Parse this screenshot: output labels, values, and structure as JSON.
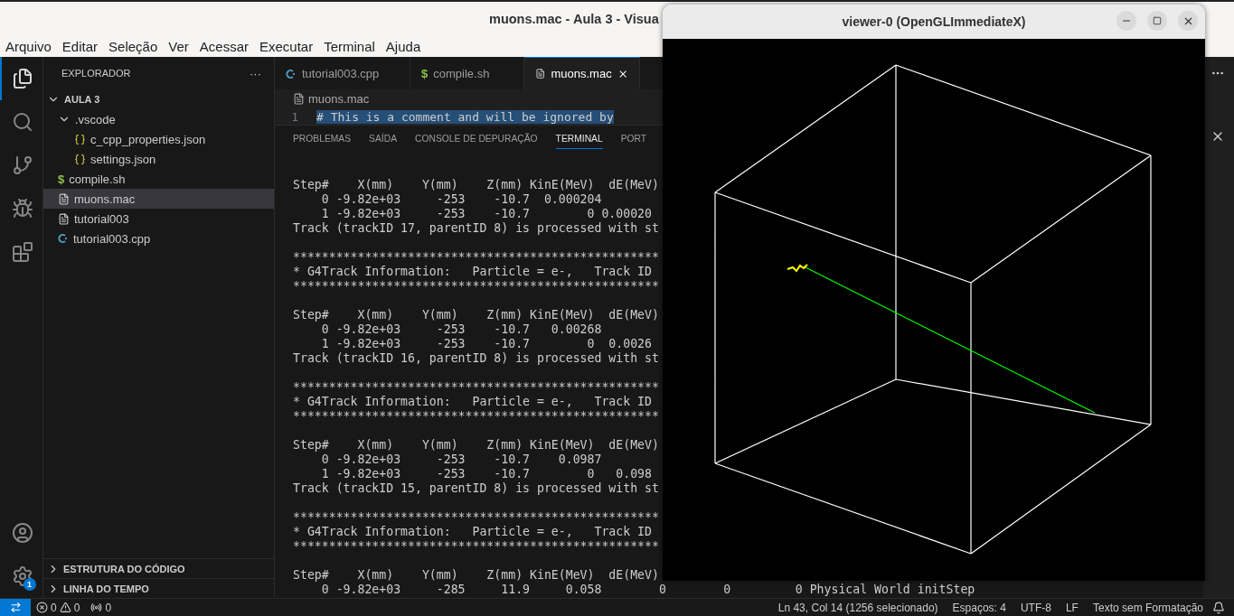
{
  "window": {
    "title": "muons.mac - Aula 3 - Visua"
  },
  "menu": [
    "Arquivo",
    "Editar",
    "Seleção",
    "Ver",
    "Acessar",
    "Executar",
    "Terminal",
    "Ajuda"
  ],
  "activity_bar": [
    {
      "kind": "files",
      "selected": true
    },
    {
      "kind": "search",
      "selected": false
    },
    {
      "kind": "source-control",
      "selected": false
    },
    {
      "kind": "run-debug",
      "selected": false
    },
    {
      "kind": "extensions",
      "selected": false
    }
  ],
  "activity_bottom": {
    "settings_badge": "1"
  },
  "sidebar": {
    "title": "EXPLORADOR",
    "more": "···",
    "tree": [
      {
        "label": "AULA 3",
        "kind": "root",
        "expanded": true,
        "selected": false,
        "children": [
          {
            "label": ".vscode",
            "kind": "folder",
            "expanded": true,
            "selected": false,
            "children": [
              {
                "label": "c_cpp_properties.json",
                "kind": "json",
                "selected": false
              },
              {
                "label": "settings.json",
                "kind": "json",
                "selected": false
              }
            ]
          },
          {
            "label": "compile.sh",
            "kind": "shell",
            "icon": "$",
            "selected": false
          },
          {
            "label": "muons.mac",
            "kind": "text",
            "selected": true
          },
          {
            "label": "tutorial003",
            "kind": "text",
            "selected": false
          },
          {
            "label": "tutorial003.cpp",
            "kind": "cpp",
            "selected": false
          }
        ]
      }
    ],
    "sections": [
      {
        "label": "ESTRUTURA DO CÓDIGO",
        "expanded": false
      },
      {
        "label": "LINHA DO TEMPO",
        "expanded": false
      }
    ]
  },
  "editor": {
    "tabs": [
      {
        "label": "tutorial003.cpp",
        "kind": "cpp",
        "selected": false
      },
      {
        "label": "compile.sh",
        "kind": "shell",
        "icon": "$",
        "selected": false
      },
      {
        "label": "muons.mac",
        "kind": "text",
        "selected": true
      }
    ],
    "breadcrumb": "muons.mac",
    "lines": [
      {
        "number": "1",
        "text": "# This is a comment and will be ignored by",
        "selected": true
      }
    ]
  },
  "panel": {
    "tabs": [
      {
        "label": "PROBLEMAS",
        "selected": false
      },
      {
        "label": "SAÍDA",
        "selected": false
      },
      {
        "label": "CONSOLE DE DEPURAÇÃO",
        "selected": false
      },
      {
        "label": "TERMINAL",
        "selected": true
      },
      {
        "label": "PORT",
        "selected": false
      }
    ],
    "terminal_blocks": [
      [
        "Step#    X(mm)    Y(mm)    Z(mm) KinE(MeV)  dE(MeV)",
        "    0 -9.82e+03     -253    -10.7  0.000204",
        "    1 -9.82e+03     -253    -10.7        0 0.00020",
        "Track (trackID 17, parentID 8) is processed with st"
      ],
      [
        "***************************************************",
        "* G4Track Information:   Particle = e-,   Track ID",
        "***************************************************"
      ],
      [
        "Step#    X(mm)    Y(mm)    Z(mm) KinE(MeV)  dE(MeV)",
        "    0 -9.82e+03     -253    -10.7   0.00268",
        "    1 -9.82e+03     -253    -10.7        0  0.0026",
        "Track (trackID 16, parentID 8) is processed with st"
      ],
      [
        "***************************************************",
        "* G4Track Information:   Particle = e-,   Track ID",
        "***************************************************"
      ],
      [
        "Step#    X(mm)    Y(mm)    Z(mm) KinE(MeV)  dE(MeV)",
        "    0 -9.82e+03     -253    -10.7    0.0987",
        "    1 -9.82e+03     -253    -10.7        0   0.098",
        "Track (trackID 15, parentID 8) is processed with st"
      ],
      [
        "***************************************************",
        "* G4Track Information:   Particle = e-,   Track ID",
        "***************************************************"
      ],
      [
        "Step#    X(mm)    Y(mm)    Z(mm) KinE(MeV)  dE(MeV)",
        "    0 -9.82e+03     -285     11.9     0.058        0        0         0 Physical World initStep"
      ]
    ]
  },
  "status_bar": {
    "errors": "0",
    "warnings": "0",
    "ports": "0",
    "right": [
      "Ln 43, Col 14 (1256 selecionado)",
      "Espaços: 4",
      "UTF-8",
      "LF",
      "Texto sem Formatação"
    ]
  },
  "viewer": {
    "title": "viewer-0 (OpenGLImmediateX)"
  }
}
